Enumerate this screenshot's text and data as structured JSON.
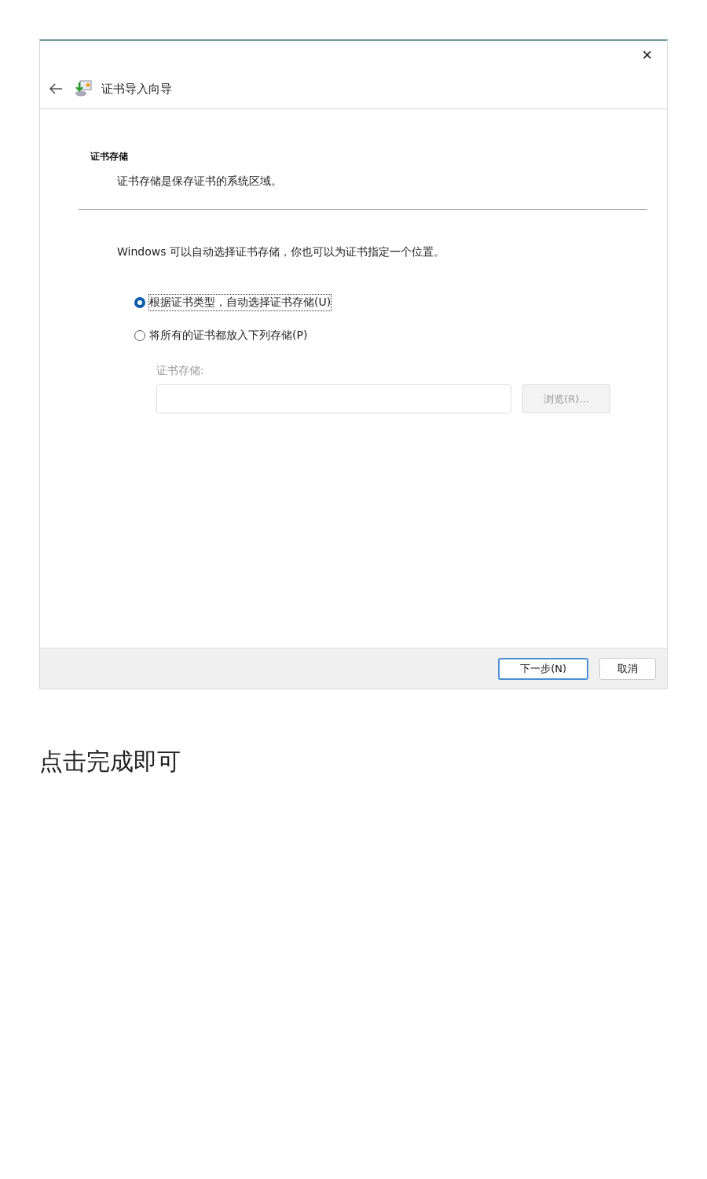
{
  "window": {
    "title": "证书导入向导",
    "close": "✕"
  },
  "section": {
    "heading": "证书存储",
    "description": "证书存储是保存证书的系统区域。"
  },
  "intro": "Windows 可以自动选择证书存储，你也可以为证书指定一个位置。",
  "options": [
    {
      "label": "根据证书类型，自动选择证书存储(U)",
      "selected": true
    },
    {
      "label": "将所有的证书都放入下列存储(P)",
      "selected": false
    }
  ],
  "store": {
    "label": "证书存储:",
    "disabled": true,
    "browse": "浏览(R)..."
  },
  "buttons": [
    {
      "label": "下一步(N)",
      "kind": "primary"
    },
    {
      "label": "取消",
      "kind": "secondary"
    }
  ],
  "caption": "点击完成即可"
}
